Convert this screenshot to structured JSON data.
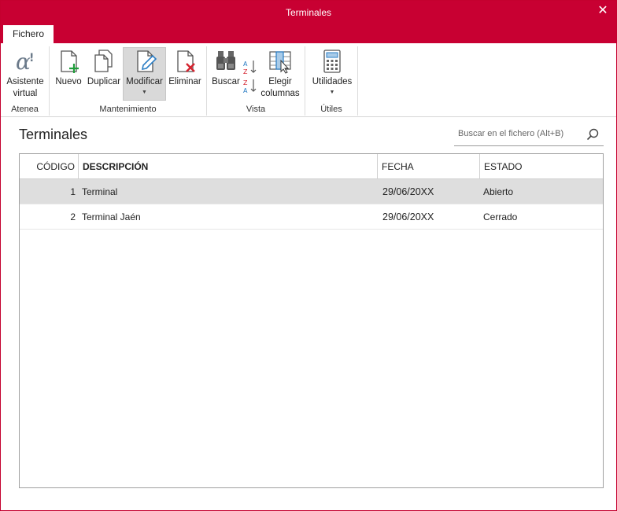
{
  "window": {
    "title": "Terminales"
  },
  "tabs": [
    {
      "label": "Fichero"
    }
  ],
  "ribbon": {
    "groups": [
      {
        "label": "Atenea"
      },
      {
        "label": "Mantenimiento"
      },
      {
        "label": "Vista"
      },
      {
        "label": "Útiles"
      }
    ],
    "buttons": {
      "asistente": "Asistente virtual",
      "asistente_l1": "Asistente",
      "asistente_l2": "virtual",
      "nuevo": "Nuevo",
      "duplicar": "Duplicar",
      "modificar": "Modificar",
      "eliminar": "Eliminar",
      "buscar": "Buscar",
      "elegir_l1": "Elegir",
      "elegir_l2": "columnas",
      "utilidades": "Utilidades"
    }
  },
  "main": {
    "title": "Terminales",
    "search": {
      "placeholder": "Buscar en el fichero (Alt+B)"
    }
  },
  "table": {
    "columns": [
      "CÓDIGO",
      "DESCRIPCIÓN",
      "FECHA",
      "ESTADO"
    ],
    "rows": [
      {
        "codigo": "1",
        "descripcion": "Terminal",
        "fecha": "29/06/20XX",
        "estado": "Abierto",
        "selected": true
      },
      {
        "codigo": "2",
        "descripcion": "Terminal Jaén",
        "fecha": "29/06/20XX",
        "estado": "Cerrado",
        "selected": false
      }
    ]
  },
  "colors": {
    "accent": "#c80032",
    "selected_row": "#dedede",
    "ribbon_active": "#d9d9d9"
  },
  "icons": [
    "alpha-assistant-icon",
    "new-document-icon",
    "duplicate-icon",
    "edit-document-icon",
    "delete-document-icon",
    "binoculars-icon",
    "sort-az-icon",
    "sort-za-icon",
    "choose-columns-icon",
    "calculator-icon",
    "search-icon",
    "close-icon"
  ]
}
